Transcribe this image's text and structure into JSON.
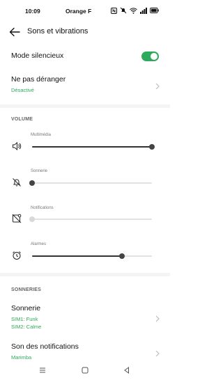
{
  "status_bar": {
    "time": "10:09",
    "carrier": "Orange F",
    "icons": [
      "nfc-icon",
      "mute-icon",
      "wifi-icon",
      "signal-icon",
      "battery-icon"
    ]
  },
  "header": {
    "title": "Sons et vibrations",
    "back_icon": "back-arrow-icon"
  },
  "silent_mode": {
    "label": "Mode silencieux",
    "enabled": true,
    "accent": "#2eaa5c"
  },
  "dnd": {
    "label": "Ne pas déranger",
    "status": "Désactivé"
  },
  "volume": {
    "section_title": "VOLUME",
    "sliders": [
      {
        "label": "Multimédia",
        "icon": "speaker-icon",
        "level": 1.0,
        "enabled": true
      },
      {
        "label": "Sonnerie",
        "icon": "ringer-off-icon",
        "level": 0.0,
        "enabled": true
      },
      {
        "label": "Notifications",
        "icon": "notification-off-icon",
        "level": 0.0,
        "enabled": false
      },
      {
        "label": "Alarmes",
        "icon": "alarm-icon",
        "level": 0.75,
        "enabled": true
      }
    ]
  },
  "ringtones": {
    "section_title": "SONNERIES",
    "ringtone": {
      "label": "Sonnerie",
      "sim1": "SIM1: Funk",
      "sim2": "SIM2: Calme"
    },
    "notification_sound": {
      "label": "Son des notifications",
      "value": "Marimba"
    }
  },
  "nav": {
    "icons": [
      "menu-icon",
      "home-icon",
      "back-icon"
    ]
  }
}
